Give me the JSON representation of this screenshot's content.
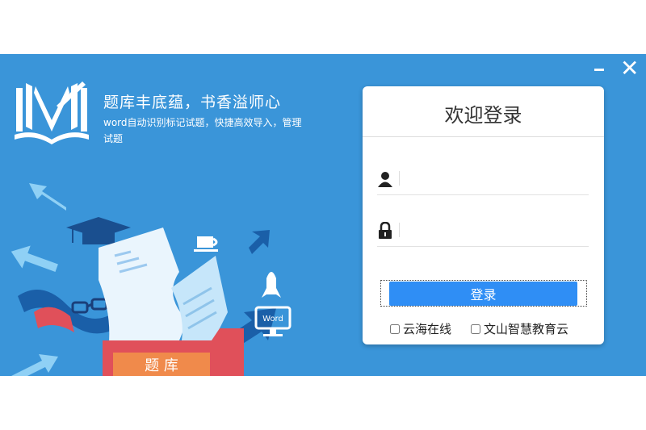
{
  "window": {
    "slogan": "题库丰底蕴，书香溢师心",
    "description": "word自动识别标记试题，快捷高效导入，管理试题",
    "illustration": {
      "box_label": "题 库",
      "word_label": "Word"
    }
  },
  "login": {
    "title": "欢迎登录",
    "username": {
      "value": "",
      "placeholder": ""
    },
    "password": {
      "value": "",
      "placeholder": ""
    },
    "submit_label": "登录",
    "options": [
      {
        "label": "云海在线",
        "checked": false
      },
      {
        "label": "文山智慧教育云",
        "checked": false
      }
    ]
  },
  "colors": {
    "background": "#3a95d9",
    "button": "#2f8ef5",
    "box_red": "#e0505a",
    "box_label_bg": "#f08a4b"
  }
}
